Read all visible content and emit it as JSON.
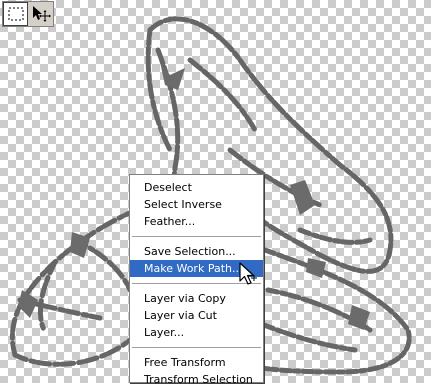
{
  "toolbar": {
    "tools": [
      {
        "name": "rectangular-marquee-tool",
        "icon": "dashed-rectangle-icon",
        "active": true
      },
      {
        "name": "move-tool",
        "icon": "move-arrow-icon",
        "active": false
      }
    ]
  },
  "canvas": {
    "background": "transparency-checkerboard",
    "content": "shoes-line-art-with-selection-marquee"
  },
  "context_menu": {
    "groups": [
      [
        {
          "label": "Deselect"
        },
        {
          "label": "Select Inverse"
        },
        {
          "label": "Feather..."
        }
      ],
      [
        {
          "label": "Save Selection..."
        },
        {
          "label": "Make Work Path...",
          "highlighted": true
        }
      ],
      [
        {
          "label": "Layer via Copy"
        },
        {
          "label": "Layer via Cut"
        },
        {
          "label": "Layer..."
        }
      ],
      [
        {
          "label": "Free Transform"
        },
        {
          "label": "Transform Selection"
        }
      ]
    ]
  },
  "colors": {
    "highlight": "#316ac5",
    "toolbar_bg": "#d4d0c8",
    "selection_gray": "#6b6b6b"
  }
}
